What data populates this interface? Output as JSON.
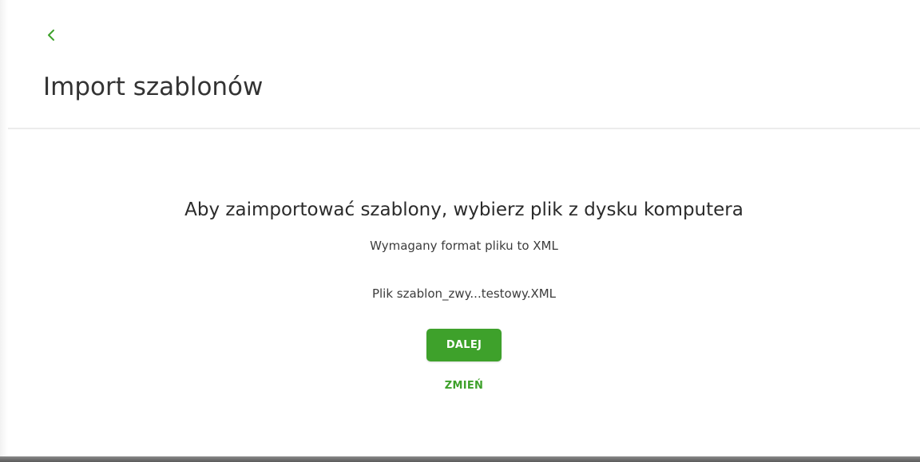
{
  "header": {
    "back_icon": "chevron-left-icon",
    "title": "Import szablonów"
  },
  "main": {
    "headline": "Aby zaimportować szablony, wybierz plik z dysku komputera",
    "format_info": "Wymagany format pliku to XML",
    "file_info": "Plik szablon_zwy...testowy.XML",
    "next_label": "DALEJ",
    "change_label": "ZMIEŃ"
  },
  "colors": {
    "accent": "#3ea12b",
    "title_text": "#333333",
    "body_text": "#3c3c3c",
    "divider": "#ececec"
  }
}
